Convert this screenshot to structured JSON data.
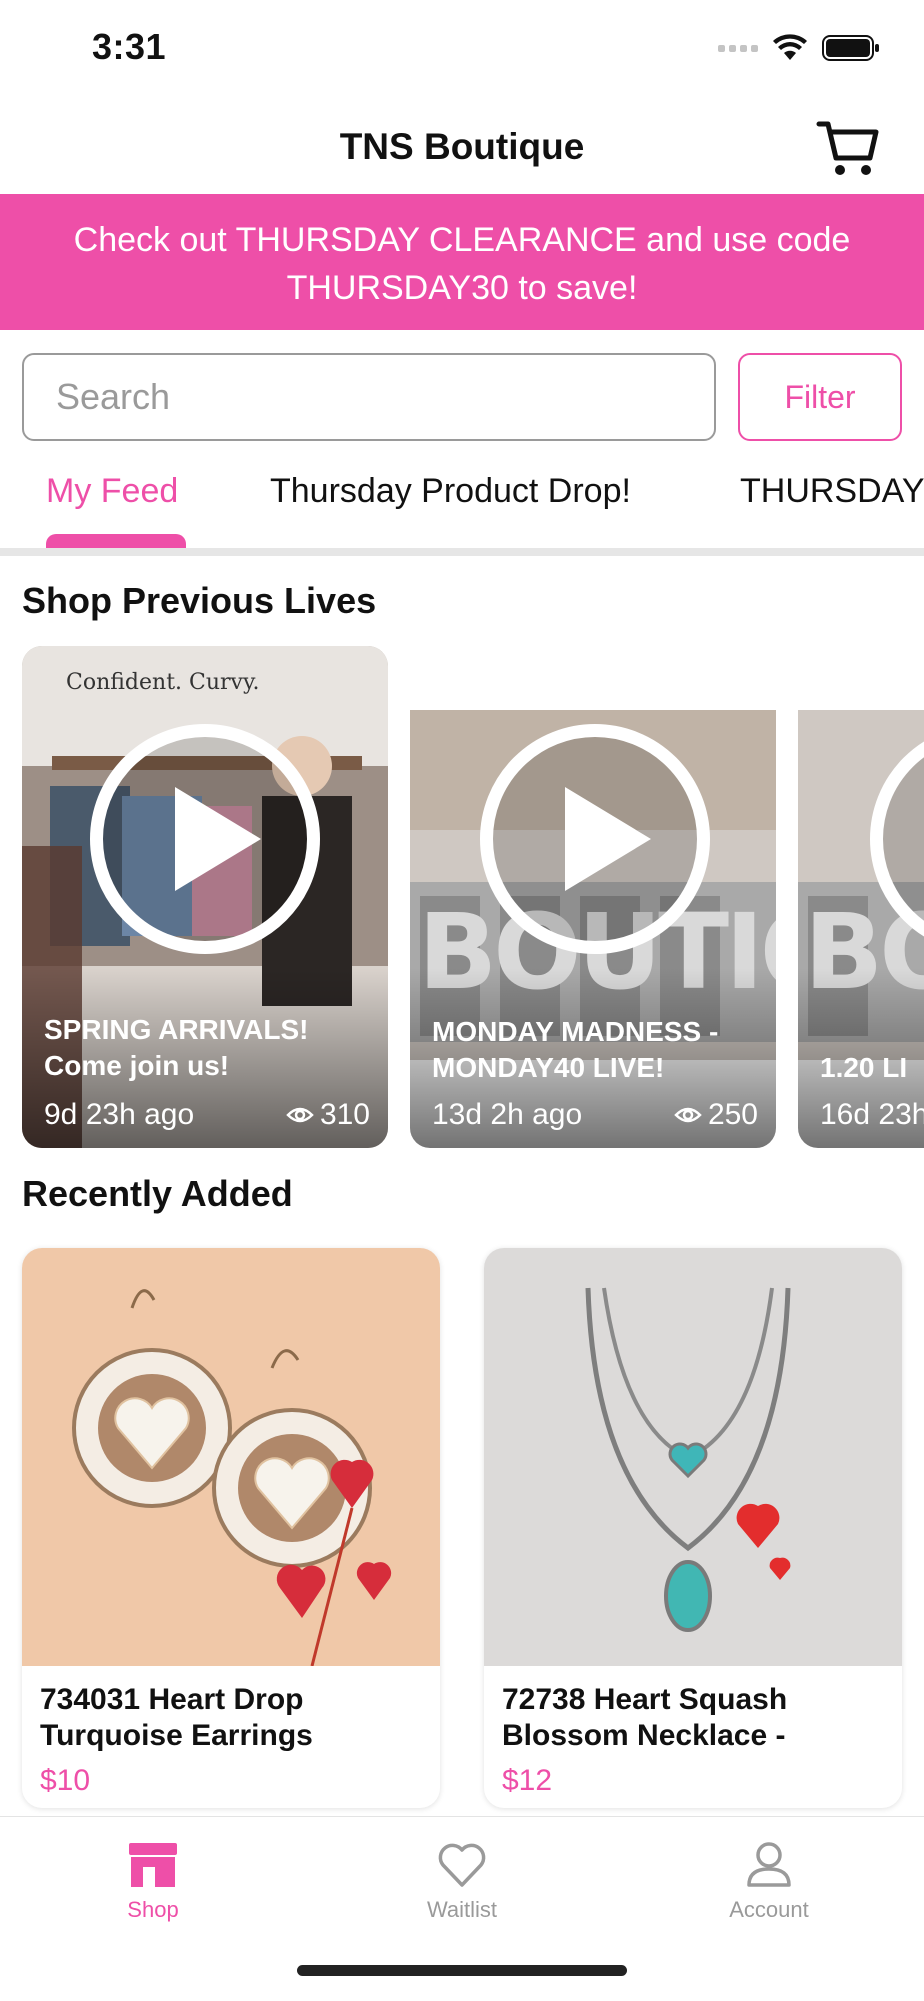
{
  "status_bar": {
    "time": "3:31"
  },
  "header": {
    "title": "TNS Boutique",
    "cart_icon": "cart-icon"
  },
  "promo": {
    "text": "Check out THURSDAY CLEARANCE and use code THURSDAY30 to save!"
  },
  "search": {
    "placeholder": "Search",
    "filter_label": "Filter"
  },
  "tabs": [
    {
      "label": "My Feed",
      "active": true
    },
    {
      "label": "Thursday Product Drop!",
      "active": false
    },
    {
      "label": "THURSDAY",
      "active": false
    }
  ],
  "previous_lives": {
    "title": "Shop Previous Lives",
    "items": [
      {
        "title": "SPRING ARRIVALS! Come join us!",
        "ago": "9d 23h ago",
        "views": "310",
        "thumb_text": "Confident. Curvy."
      },
      {
        "title": "MONDAY MADNESS - MONDAY40 LIVE!",
        "ago": "13d 2h ago",
        "views": "250",
        "thumb_text": "BOUTIQUE"
      },
      {
        "title": "1.20 LI",
        "ago": "16d 23h",
        "views": "",
        "thumb_text": "BOU"
      }
    ]
  },
  "recently_added": {
    "title": "Recently Added",
    "items": [
      {
        "name": "734031 Heart Drop Turquoise Earrings",
        "price": "$10"
      },
      {
        "name": "72738 Heart Squash Blossom Necklace -",
        "price": "$12"
      }
    ]
  },
  "bottom_nav": [
    {
      "label": "Shop",
      "icon": "shop-icon",
      "active": true
    },
    {
      "label": "Waitlist",
      "icon": "heart-icon",
      "active": false
    },
    {
      "label": "Account",
      "icon": "account-icon",
      "active": false
    }
  ],
  "colors": {
    "accent": "#ee4fa8",
    "muted": "#9a9a9a"
  }
}
